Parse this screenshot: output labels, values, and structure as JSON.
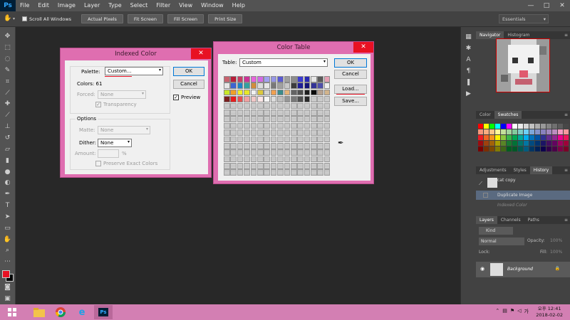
{
  "app": {
    "logo": "Ps"
  },
  "menu": [
    "File",
    "Edit",
    "Image",
    "Layer",
    "Type",
    "Select",
    "Filter",
    "View",
    "Window",
    "Help"
  ],
  "window_controls": [
    "—",
    "□",
    "✕"
  ],
  "options_bar": {
    "scroll_all": "Scroll All Windows",
    "buttons": [
      "Actual Pixels",
      "Fit Screen",
      "Fill Screen",
      "Print Size"
    ],
    "workspace": "Essentials"
  },
  "indexed_color": {
    "title": "Indexed Color",
    "palette_label": "Palette:",
    "palette_value": "Custom...",
    "colors_label": "Colors: 61",
    "forced_label": "Forced:",
    "forced_value": "None",
    "transparency": "Transparency",
    "options_legend": "Options",
    "matte_label": "Matte:",
    "matte_value": "None",
    "dither_label": "Dither:",
    "dither_value": "None",
    "amount_label": "Amount:",
    "amount_unit": "%",
    "preserve": "Preserve Exact Colors",
    "ok": "OK",
    "cancel": "Cancel",
    "preview": "Preview"
  },
  "color_table": {
    "title": "Color Table",
    "table_label": "Table:",
    "table_value": "Custom",
    "ok": "OK",
    "cancel": "Cancel",
    "load": "Load...",
    "save": "Save...",
    "colors": [
      "#c8626e",
      "#b81e3a",
      "#c83c64",
      "#cc3296",
      "#e664dc",
      "#d26ae6",
      "#a0a0f0",
      "#9696e6",
      "#5a5ad2",
      "#a0a0a0",
      "#8c8c8c",
      "#3c3cd2",
      "#2828b4",
      "#e6e6e6",
      "#5a5a5a",
      "#e6a0b4",
      "#e6e6e6",
      "#3c64d2",
      "#1e82c8",
      "#32a0a0",
      "#d28c3c",
      "#dcdcdc",
      "#e6e6e6",
      "#787878",
      "#a0a0a0",
      "#c8c8c8",
      "#3c3c3c",
      "#1e1e96",
      "#141478",
      "#323296",
      "#5050aa",
      "#f0f0f0",
      "#c8e628",
      "#f0a028",
      "#f0f028",
      "#e6e628",
      "#f0f0f0",
      "#dcc83c",
      "#d2d2d2",
      "#f0a050",
      "#3c8c8c",
      "#e6b478",
      "#646464",
      "#505050",
      "#1e1e1e",
      "#0a0a0a",
      "#b4a090",
      "#d2b48c",
      "#7a1e1e",
      "#e61e1e",
      "#e65050",
      "#f0a0a0",
      "#f0c8c8",
      "#ffe6e6",
      "#f5f5f5",
      "#dcdcdc",
      "#bebebe",
      "#969696",
      "#787878",
      "#505050",
      "#2a2a2a",
      "#000000",
      "#ffffff",
      "#e8e8e8"
    ]
  },
  "panels": {
    "navigator_tabs": [
      "Navigator",
      "Histogram"
    ],
    "color_tabs": [
      "Color",
      "Swatches"
    ],
    "history_tabs": [
      "Adjustments",
      "Styles",
      "History"
    ],
    "history_items": [
      "cat copy",
      "Duplicate Image",
      "Indexed Color"
    ],
    "layers_tabs": [
      "Layers",
      "Channels",
      "Paths"
    ],
    "kind": "Kind",
    "blend_mode": "Normal",
    "opacity_label": "Opacity:",
    "opacity_value": "100%",
    "lock_label": "Lock:",
    "fill_label": "Fill:",
    "fill_value": "100%",
    "layer_name": "Background"
  },
  "swatches": [
    "#ff0000",
    "#ffff00",
    "#00ff00",
    "#00ffff",
    "#0000ff",
    "#ff00ff",
    "#ffffff",
    "#ebebeb",
    "#d6d6d6",
    "#c2c2c2",
    "#adadad",
    "#999999",
    "#858585",
    "#707070",
    "#5c5c5c",
    "#474747",
    "#f7977a",
    "#f9ad81",
    "#fdc68a",
    "#fff79a",
    "#c4df9b",
    "#a3d39c",
    "#82ca9d",
    "#7bcdc8",
    "#6ecff6",
    "#7ea7d8",
    "#8493ca",
    "#8882be",
    "#a187be",
    "#bc8dbf",
    "#f49ac2",
    "#f6989d",
    "#ed1c24",
    "#f26522",
    "#f7941d",
    "#fff200",
    "#8dc73f",
    "#39b54a",
    "#00a651",
    "#00a99d",
    "#00aeef",
    "#0072bc",
    "#0054a6",
    "#2e3192",
    "#662d91",
    "#92278f",
    "#ec008c",
    "#ed145b",
    "#9e0b0f",
    "#a0410d",
    "#a36209",
    "#aba000",
    "#598527",
    "#197b30",
    "#007236",
    "#00746b",
    "#0076a3",
    "#004b80",
    "#003471",
    "#1b1464",
    "#440e62",
    "#630460",
    "#9e005d",
    "#9e0039",
    "#790000",
    "#7b2e00",
    "#7d4900",
    "#827b00",
    "#406618",
    "#005e20",
    "#005826",
    "#005952",
    "#005b7f",
    "#003663",
    "#002157",
    "#0d004c",
    "#32004b",
    "#4b0049",
    "#7b0046",
    "#7a0026"
  ],
  "taskbar": {
    "time": "오후 12:41",
    "date": "2018-02-02",
    "ime": "가"
  },
  "colors": {
    "dialog_frame": "#df6eb0",
    "close_red": "#e81123",
    "fg_color": "#e81123",
    "bg_color": "#000000"
  }
}
